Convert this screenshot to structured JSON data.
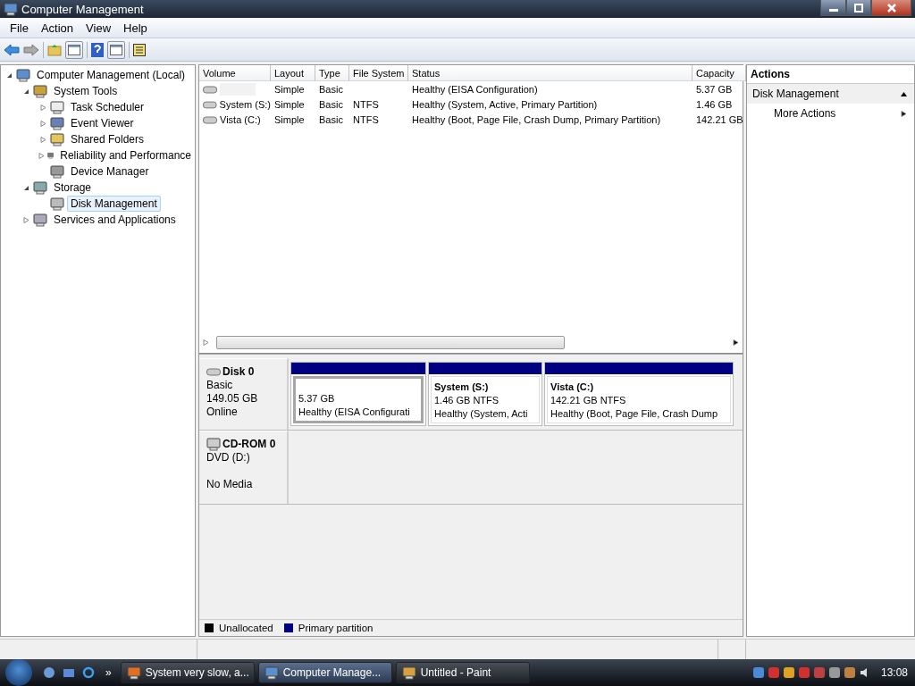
{
  "window": {
    "title": "Computer Management"
  },
  "menu": [
    "File",
    "Action",
    "View",
    "Help"
  ],
  "tree": [
    {
      "label": "Computer Management (Local)",
      "expanded": true,
      "selected": false,
      "children": [
        {
          "label": "System Tools",
          "expanded": true,
          "selected": false,
          "children": [
            {
              "label": "Task Scheduler",
              "expanded": false,
              "selected": false
            },
            {
              "label": "Event Viewer",
              "expanded": false,
              "selected": false
            },
            {
              "label": "Shared Folders",
              "expanded": false,
              "selected": false
            },
            {
              "label": "Reliability and Performance",
              "expanded": false,
              "selected": false
            },
            {
              "label": "Device Manager",
              "selected": false
            }
          ]
        },
        {
          "label": "Storage",
          "expanded": true,
          "selected": false,
          "children": [
            {
              "label": "Disk Management",
              "selected": true
            }
          ]
        },
        {
          "label": "Services and Applications",
          "expanded": false,
          "selected": false
        }
      ]
    }
  ],
  "table": {
    "columns": [
      "Volume",
      "Layout",
      "Type",
      "File System",
      "Status",
      "Capacity"
    ],
    "rows": [
      {
        "layout": "Simple",
        "type": "Basic",
        "status": "Healthy (EISA Configuration)",
        "capacity": "5.37 GB"
      },
      {
        "volume": "System (S:)",
        "layout": "Simple",
        "type": "Basic",
        "file_system": "NTFS",
        "status": "Healthy (System, Active, Primary Partition)",
        "capacity": "1.46 GB"
      },
      {
        "volume": "Vista (C:)",
        "layout": "Simple",
        "type": "Basic",
        "file_system": "NTFS",
        "status": "Healthy (Boot, Page File, Crash Dump, Primary Partition)",
        "capacity": "142.21 GB"
      }
    ]
  },
  "disks": [
    {
      "name": "Disk 0",
      "kind": "disk",
      "lines": [
        "Basic",
        "149.05 GB",
        "Online"
      ],
      "partitions": [
        {
          "size": "5.37 GB",
          "status": "Healthy (EISA Configurati",
          "selected": true,
          "color": "#000080"
        },
        {
          "name": "System  (S:)",
          "size": "1.46 GB NTFS",
          "status": "Healthy (System, Acti",
          "selected": false,
          "color": "#000080"
        },
        {
          "name": "Vista  (C:)",
          "size": "142.21 GB NTFS",
          "status": "Healthy (Boot, Page File, Crash Dump",
          "selected": false,
          "color": "#000080"
        }
      ]
    },
    {
      "name": "CD-ROM 0",
      "kind": "cdrom",
      "lines": [
        "DVD (D:)",
        "No Media"
      ]
    }
  ],
  "legend": [
    {
      "label": "Unallocated",
      "color": "#000000"
    },
    {
      "label": "Primary partition",
      "color": "#000080"
    }
  ],
  "actions": {
    "title": "Actions",
    "section": "Disk Management",
    "items": [
      "More Actions"
    ]
  },
  "taskbar": {
    "more": "»",
    "tasks": [
      {
        "label": "System very slow, a...",
        "selected": false
      },
      {
        "label": "Computer Manage...",
        "selected": true
      },
      {
        "label": "Untitled - Paint",
        "selected": false
      }
    ],
    "time": "13:08"
  }
}
